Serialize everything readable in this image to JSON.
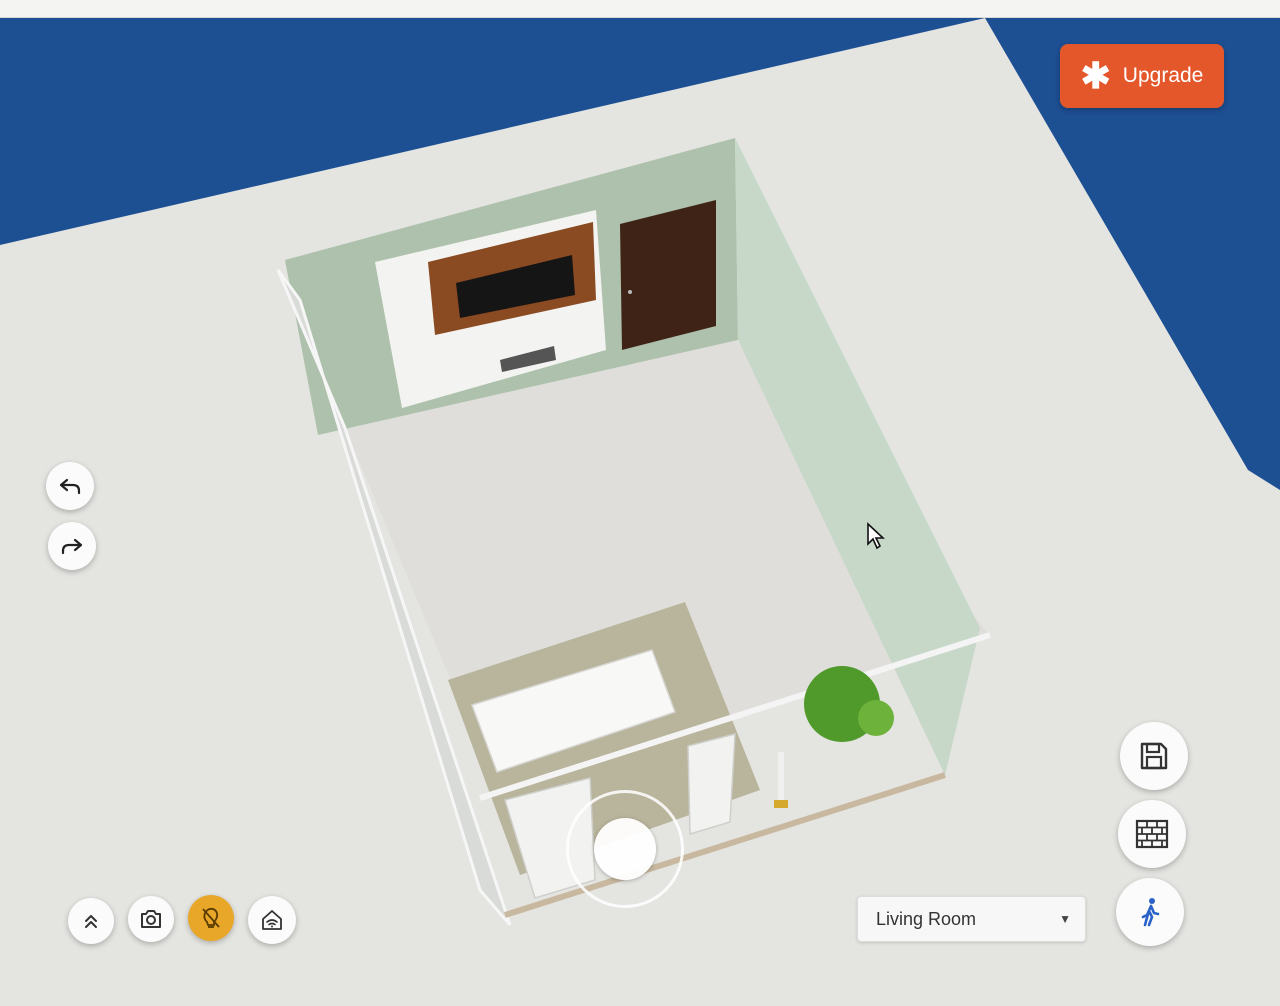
{
  "toolbar": {
    "upgrade_label": "Upgrade",
    "upgrade_icon": "asterisk-icon",
    "accent_color": "#e4572b"
  },
  "history": {
    "undo_icon": "undo-icon",
    "redo_icon": "redo-icon"
  },
  "bottom_left_tools": [
    {
      "icon": "chevron-double-up-icon"
    },
    {
      "icon": "camera-icon"
    },
    {
      "icon": "lightbulb-icon",
      "active": true,
      "active_color": "#e8a728"
    },
    {
      "icon": "home-wifi-icon"
    }
  ],
  "right_tools": [
    {
      "icon": "save-icon"
    },
    {
      "icon": "brick-wall-icon"
    },
    {
      "icon": "walk-icon"
    }
  ],
  "room_selector": {
    "selected": "Living Room"
  },
  "scene": {
    "background_color": "#1d4f93",
    "floor_color": "#e4e4e1",
    "wall_color": "#bccfbf"
  }
}
